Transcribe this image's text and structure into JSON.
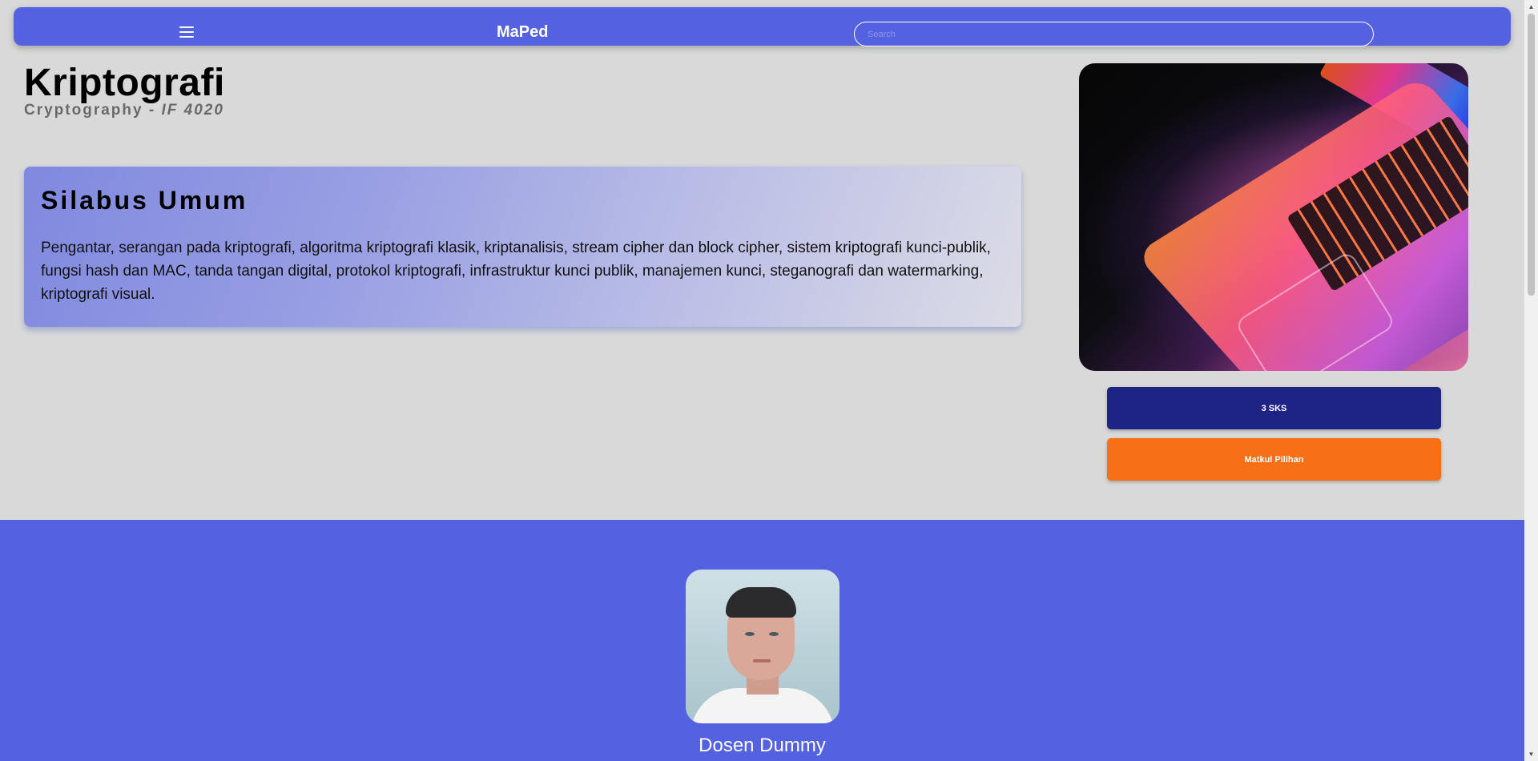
{
  "navbar": {
    "menu_icon": "hamburger-icon",
    "brand": "MaPed",
    "search_placeholder": "Search"
  },
  "course": {
    "title": "Kriptografi",
    "subtitle_en": "Cryptography",
    "subtitle_sep": "-",
    "code": "IF 4020"
  },
  "syllabus": {
    "heading": "Silabus Umum",
    "body": "Pengantar, serangan pada kriptografi, algoritma kriptografi klasik, kriptanalisis, stream cipher dan block cipher, sistem kriptografi kunci-publik, fungsi hash dan MAC, tanda tangan digital, protokol kriptografi, infrastruktur kunci publik, manajemen kunci, steganografi dan watermarking, kriptografi visual."
  },
  "badges": {
    "credits": "3 SKS",
    "type": "Matkul Pilihan"
  },
  "lecturer": {
    "name": "Dosen Dummy"
  },
  "colors": {
    "primary": "#5461e0",
    "credits_badge": "#1e2484",
    "type_badge": "#f87016",
    "page_bg": "#d9d9d9"
  }
}
